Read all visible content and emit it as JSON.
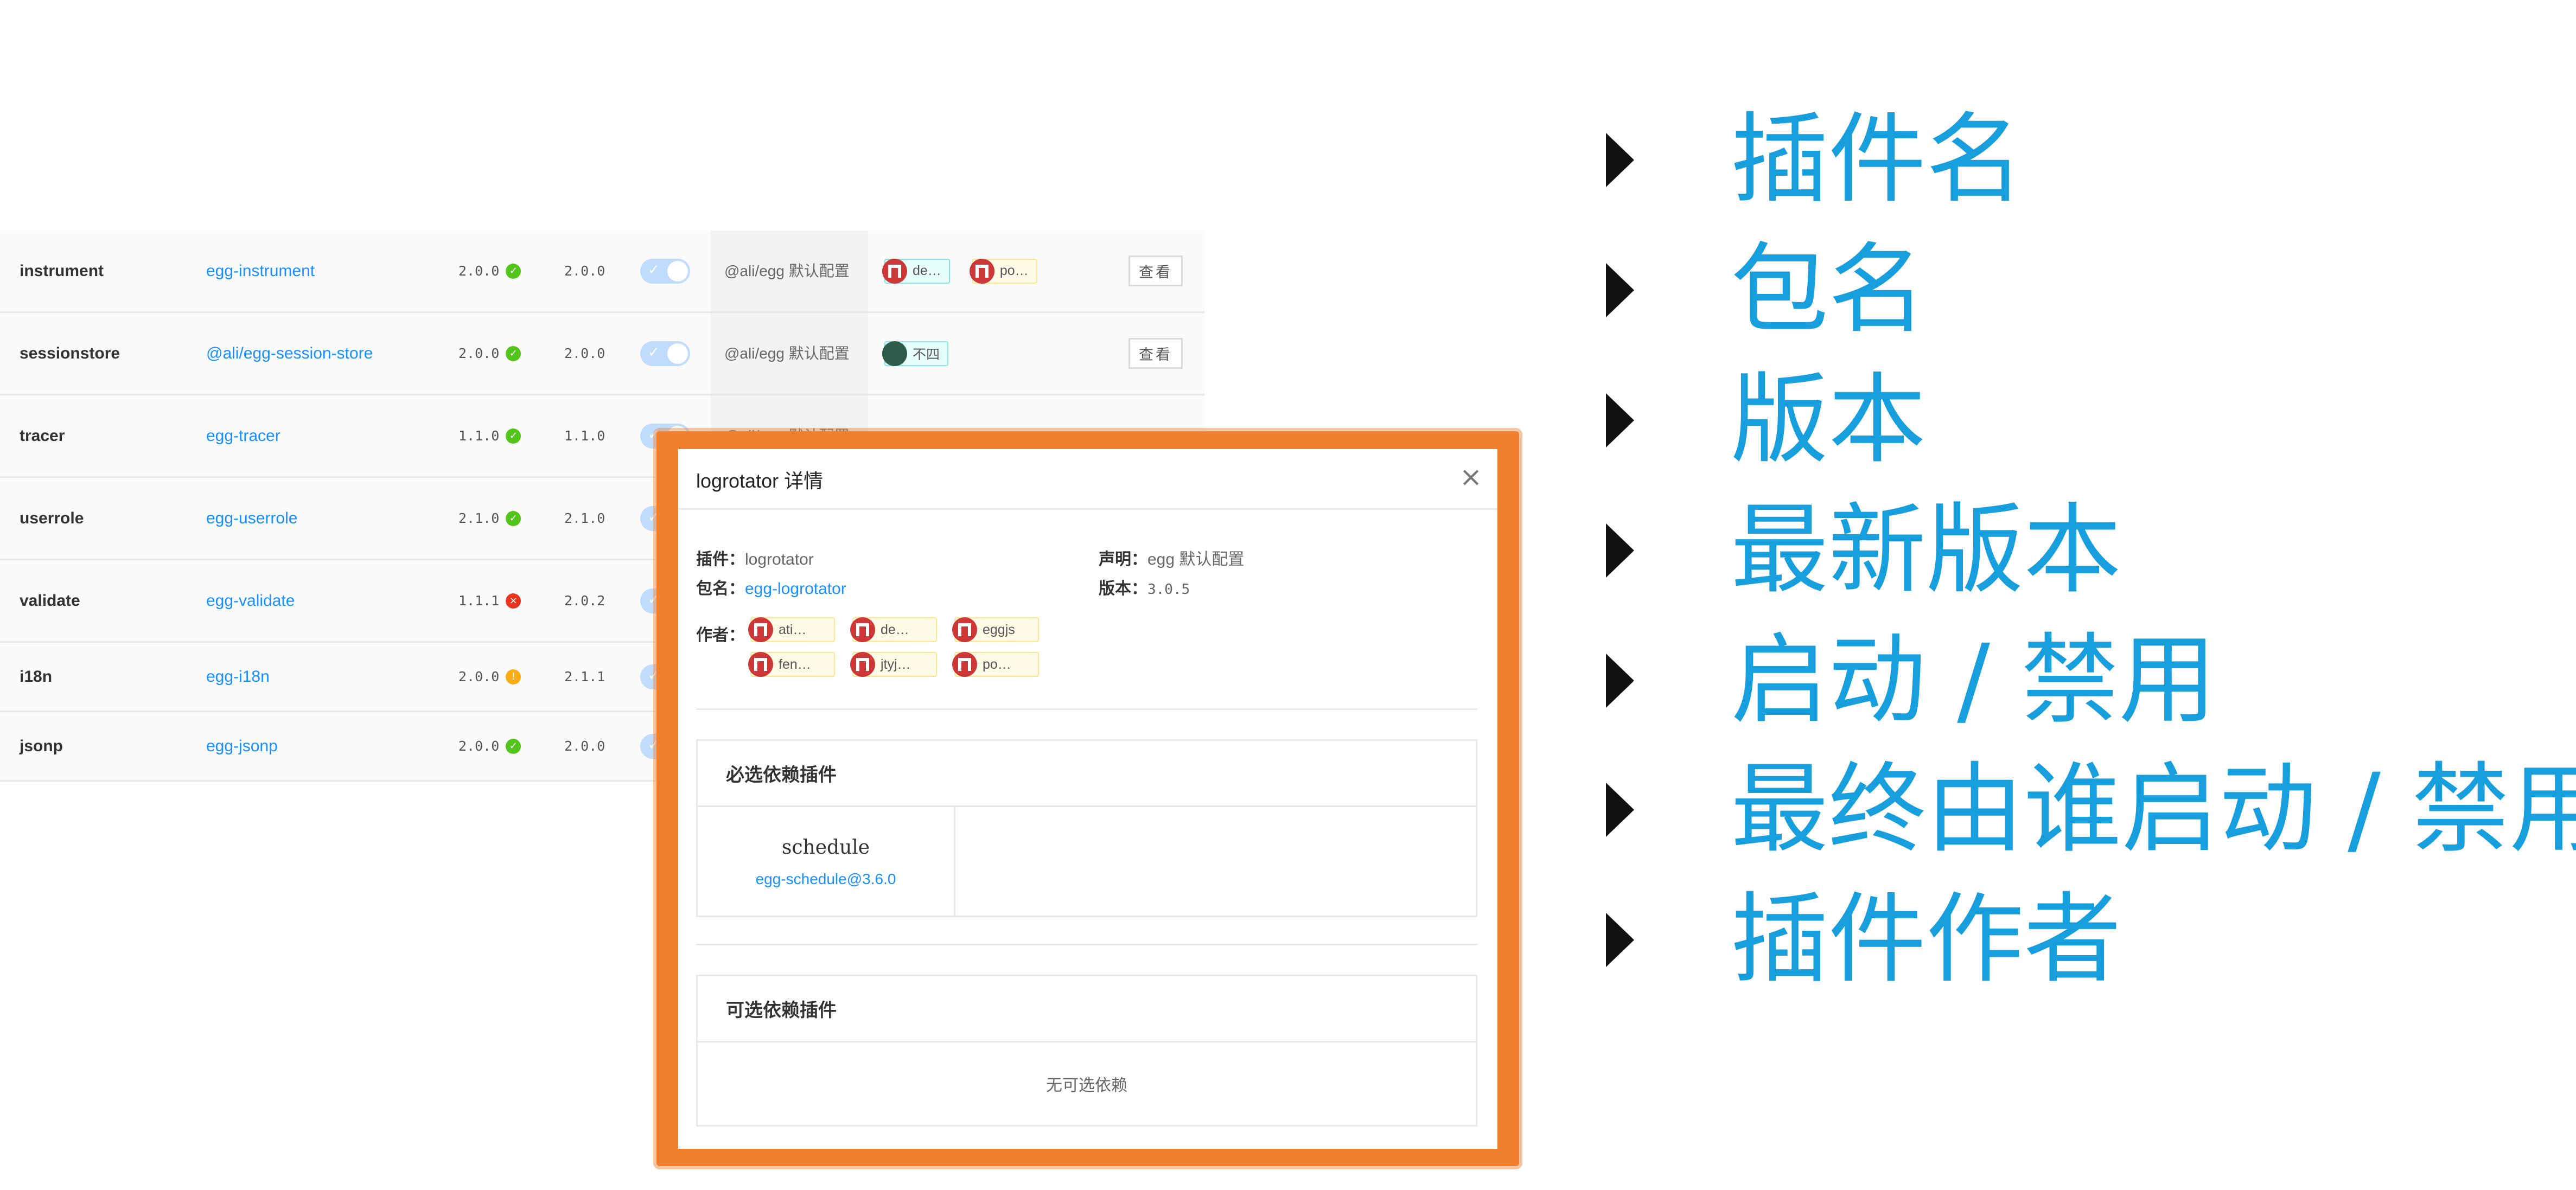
{
  "table": {
    "rows": [
      {
        "name": "instrument",
        "package": "egg-instrument",
        "version": "2.0.0",
        "status": "ok",
        "latest": "2.0.0",
        "enabled_by": "@ali/egg 默认配置",
        "authors": [
          {
            "name": "de…",
            "avatar": "npm",
            "color": "teal"
          },
          {
            "name": "po…",
            "avatar": "npm",
            "color": "yellow"
          }
        ],
        "action": "查看"
      },
      {
        "name": "sessionstore",
        "package": "@ali/egg-session-store",
        "version": "2.0.0",
        "status": "ok",
        "latest": "2.0.0",
        "enabled_by": "@ali/egg 默认配置",
        "authors": [
          {
            "name": "不四",
            "avatar": "photo",
            "color": "teal"
          }
        ],
        "action": "查看"
      },
      {
        "name": "tracer",
        "package": "egg-tracer",
        "version": "1.1.0",
        "status": "ok",
        "latest": "1.1.0",
        "enabled_by": "@ali/egg 默认配置",
        "authors": [],
        "action": ""
      },
      {
        "name": "userrole",
        "package": "egg-userrole",
        "version": "2.1.0",
        "status": "ok",
        "latest": "2.1.0",
        "enabled_by": "",
        "authors": [],
        "action": ""
      },
      {
        "name": "validate",
        "package": "egg-validate",
        "version": "1.1.1",
        "status": "err",
        "latest": "2.0.2",
        "enabled_by": "",
        "authors": [],
        "action": ""
      },
      {
        "name": "i18n",
        "package": "egg-i18n",
        "version": "2.0.0",
        "status": "warn",
        "latest": "2.1.1",
        "enabled_by": "",
        "authors": [],
        "action": ""
      },
      {
        "name": "jsonp",
        "package": "egg-jsonp",
        "version": "2.0.0",
        "status": "ok",
        "latest": "2.0.0",
        "enabled_by": "",
        "authors": [],
        "action": ""
      }
    ]
  },
  "modal": {
    "title": "logrotator 详情",
    "close_icon": "×",
    "plugin_label": "插件：",
    "plugin_value": "logrotator",
    "package_label": "包名：",
    "package_value": "egg-logrotator",
    "declare_label": "声明：",
    "declare_value": "egg 默认配置",
    "version_label": "版本：",
    "version_value": "3.0.5",
    "authors_label": "作者：",
    "authors": [
      {
        "name": "ati…",
        "avatar": "npm",
        "color": "yellow"
      },
      {
        "name": "de…",
        "avatar": "npm",
        "color": "yellow"
      },
      {
        "name": "eggjs",
        "avatar": "npm",
        "color": "yellow"
      },
      {
        "name": "fen…",
        "avatar": "npm",
        "color": "yellow"
      },
      {
        "name": "jtyj…",
        "avatar": "npm",
        "color": "yellow"
      },
      {
        "name": "po…",
        "avatar": "npm",
        "color": "yellow"
      }
    ],
    "required_title": "必选依赖插件",
    "required_deps": [
      {
        "name": "schedule",
        "version": "egg-schedule@3.6.0"
      }
    ],
    "optional_title": "可选依赖插件",
    "optional_empty": "无可选依赖"
  },
  "features": [
    "插件名",
    "包名",
    "版本",
    "最新版本",
    "启动 / 禁用",
    "最终由谁启动 / 禁用",
    "插件作者"
  ],
  "colors": {
    "accent": "#169fdc",
    "link": "#1890ff",
    "highlight_frame": "#f07f2e",
    "status_ok": "#52c41a",
    "status_err": "#e8331f",
    "status_warn": "#faad14"
  }
}
